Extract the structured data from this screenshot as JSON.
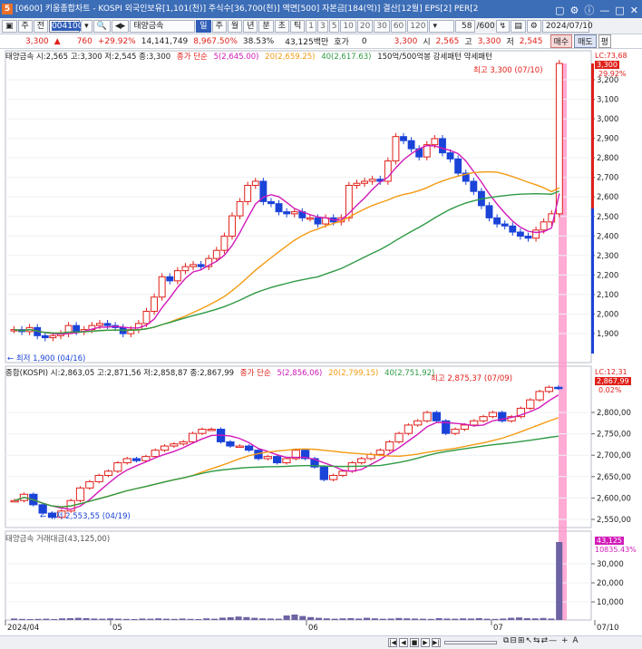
{
  "titlebar": {
    "text": "[0600] 키움종합차트 - KOSPI 외국인보유[1,101(천)] 주식수[36,700(천)] 액면[500] 자본금[184(억)] 결산[12월] EPS[2] PER[2"
  },
  "toolbar": {
    "items": [
      "주",
      "전"
    ],
    "code": "004100",
    "name": "태양금속",
    "periods": [
      "일",
      "주",
      "월",
      "년",
      "분",
      "초",
      "틱"
    ],
    "intervals": [
      "1",
      "3",
      "5",
      "10",
      "20",
      "30",
      "60",
      "120"
    ],
    "count": "58",
    "count_total": "/600",
    "date": "2024/07/10"
  },
  "quote": {
    "price": "3,300",
    "change": "760",
    "change_pct": "+29.92%",
    "volume": "14,141,749",
    "vol_ratio": "8,967.50%",
    "turnover": "38.53%",
    "amount": "43,125백만",
    "hoga_label": "호가",
    "hoga": "0",
    "hoga_price": "3,300",
    "open_label": "시",
    "open": "2,565",
    "high_label": "고",
    "high": "3,300",
    "low_label": "저",
    "low": "2,545",
    "buy": "매수",
    "sell": "매도",
    "avg": "평"
  },
  "legend1": {
    "title": "태양금속 시:2,565 고:3,300 저:2,545 종:3,300",
    "ma_label": "종가 단순",
    "ma5": "5(2,645.00)",
    "ma20": "20(2,659.25)",
    "ma40": "40(2,617.63)",
    "extra": "150억/500억봉 강세패턴 약세패턴"
  },
  "legend2": {
    "title": "종합(KOSPI) 시:2,863,05 고:2,871,56 저:2,858,87 종:2,867,99",
    "ma_label": "종가 단순",
    "ma5": "5(2,856,06)",
    "ma20": "20(2,799,15)",
    "ma40": "40(2,751,92)"
  },
  "legend3": {
    "title": "태양금속 거래대금(43,125,00)"
  },
  "annot": {
    "high1": "최고 3,300 (07/10)",
    "low1": "최저 1,900 (04/16)",
    "high2": "최고 2,875,37 (07/09)",
    "low2": "최저 2,553,55 (04/19)"
  },
  "right1": {
    "lc": "LC:73,68",
    "last": "3,300",
    "pct": "29.92%"
  },
  "right2": {
    "lc": "LC:12,31",
    "last": "2,867,99",
    "pct": "0.02%"
  },
  "right3": {
    "last": "43,125",
    "sub": "10835.43%"
  },
  "axis1": [
    "3,200",
    "3,100",
    "3,000",
    "2,900",
    "2,800",
    "2,700",
    "2,600",
    "2,500",
    "2,400",
    "2,300",
    "2,200",
    "2,100",
    "2,000",
    "1,900"
  ],
  "axis2": [
    "2,800,00",
    "2,750,00",
    "2,700,00",
    "2,650,00",
    "2,600,00",
    "2,550,00"
  ],
  "axis3": [
    "30,000",
    "20,000",
    "10,000"
  ],
  "xaxis": [
    "2024/04",
    "05",
    "06",
    "07",
    "07/10"
  ],
  "colors": {
    "up": "#e0201a",
    "down": "#1a43d8",
    "ma5": "#d11ab8",
    "ma20": "#f39a12",
    "ma40": "#2f9a45",
    "highlight": "#ff8fc8"
  },
  "chart_data": {
    "type": "candlestick",
    "series": [
      {
        "name": "태양금속",
        "values": [
          1990,
          1980,
          2000,
          1960,
          1950,
          1960,
          1970,
          2010,
          1980,
          1990,
          2010,
          2020,
          2010,
          2000,
          1970,
          1990,
          2020,
          2080,
          2150,
          2250,
          2230,
          2280,
          2300,
          2310,
          2300,
          2340,
          2380,
          2450,
          2550,
          2620,
          2700,
          2720,
          2620,
          2610,
          2570,
          2560,
          2570,
          2540,
          2540,
          2510,
          2540,
          2520,
          2540,
          2700,
          2710,
          2720,
          2730,
          2720,
          2820,
          2940,
          2920,
          2880,
          2840,
          2900,
          2930,
          2860,
          2830,
          2760,
          2720,
          2670,
          2600,
          2540,
          2510,
          2500,
          2470,
          2450,
          2440,
          2480,
          2520,
          2560,
          3300
        ]
      },
      {
        "name": "KOSPI",
        "values": [
          2600,
          2615,
          2590,
          2570,
          2560,
          2575,
          2600,
          2630,
          2645,
          2660,
          2670,
          2690,
          2700,
          2695,
          2705,
          2720,
          2730,
          2735,
          2740,
          2760,
          2770,
          2770,
          2740,
          2730,
          2730,
          2720,
          2700,
          2705,
          2690,
          2700,
          2720,
          2700,
          2680,
          2650,
          2660,
          2670,
          2690,
          2700,
          2710,
          2720,
          2740,
          2760,
          2780,
          2790,
          2810,
          2790,
          2760,
          2770,
          2780,
          2790,
          2800,
          2810,
          2790,
          2800,
          2820,
          2840,
          2860,
          2870,
          2868
        ]
      },
      {
        "name": "거래대금",
        "values": [
          800,
          600,
          500,
          600,
          700,
          500,
          900,
          1000,
          1200,
          1000,
          800,
          700,
          900,
          700,
          600,
          500,
          800,
          700,
          900,
          700,
          600,
          800,
          600,
          500,
          900,
          700,
          1300,
          1500,
          1900,
          1600,
          1200,
          900,
          800,
          700,
          2500,
          3000,
          2200,
          1600,
          1200,
          900,
          700,
          900,
          1000,
          800,
          1200,
          900,
          700,
          800,
          1100,
          900,
          800,
          700,
          600,
          1000,
          800,
          700,
          900,
          800,
          1000,
          700,
          600,
          800,
          1200,
          1400,
          1000,
          900,
          1100,
          800,
          43125
        ]
      }
    ]
  }
}
